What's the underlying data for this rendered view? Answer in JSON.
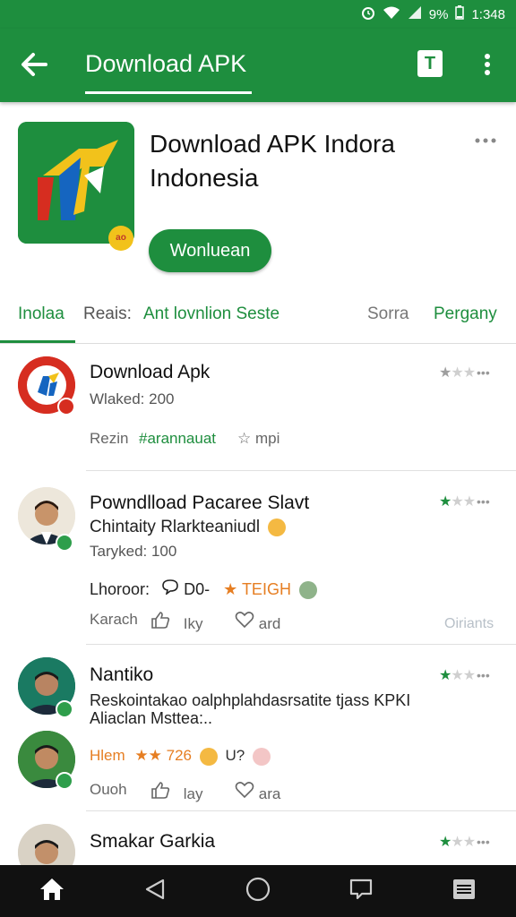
{
  "status_bar": {
    "battery": "9%",
    "time": "1:348"
  },
  "toolbar": {
    "title": "Download APK"
  },
  "app": {
    "title_line1": "Download APK Indora",
    "title_line2": "Indonesia",
    "icon_badge": "ao",
    "install_label": "Wonluean"
  },
  "tabs": [
    {
      "label": "Inolaa"
    },
    {
      "label": "Reais:"
    },
    {
      "label": "Ant lovnlion Seste"
    },
    {
      "label": "Sorra"
    },
    {
      "label": "Pergany"
    }
  ],
  "reviews": [
    {
      "name": "Download Apk",
      "line1": "Wlaked: 200",
      "action1": "Rezin",
      "action2": "#arannauat",
      "action3": "mpi",
      "rating": 1
    },
    {
      "name": "Powndlload Pacaree Slavt",
      "line1": "Chintaity Rlarkteaniudl",
      "line2": "Taryked: 100",
      "meta1": "Lhoroor:",
      "meta2": "D0-",
      "meta3": "TEIGH",
      "action1": "Karach",
      "action2": "Iky",
      "action3": "ard",
      "trailing": "Oiriants",
      "rating": 1
    },
    {
      "name": "Nantiko",
      "line1": "Reskointakao oalphplahdasrsatite tjass KPKI",
      "line2": "Aliaclan Msttea:..",
      "meta1": "Hlem",
      "meta2": "726",
      "meta3": "U?",
      "action1": "Ouoh",
      "action2": "lay",
      "action3": "ara",
      "rating": 1
    },
    {
      "name": "Smakar Garkia",
      "rating": 1
    }
  ],
  "colors": {
    "brand_green": "#1e8e3e",
    "nav_bg": "#111111"
  },
  "icons": [
    "back-arrow-icon",
    "t-icon",
    "more-vert-icon",
    "home-icon",
    "back-triangle-icon",
    "circle-home-icon",
    "chat-icon",
    "menu-icon",
    "thumbs-up-icon",
    "heart-icon",
    "comment-icon",
    "star-icon"
  ]
}
